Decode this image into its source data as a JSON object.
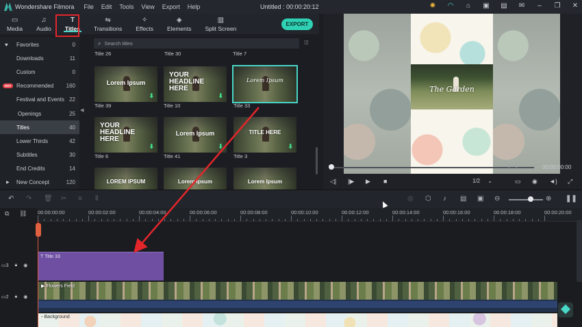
{
  "titlebar": {
    "app_name": "Wondershare Filmora",
    "menu": [
      "File",
      "Edit",
      "Tools",
      "View",
      "Export",
      "Help"
    ],
    "window_title": "Untitled : 00:00:20:12",
    "icons": [
      "lightbulb-icon",
      "headset-icon",
      "store-icon",
      "account-icon",
      "save-icon",
      "mail-icon",
      "minimize-icon",
      "restore-icon",
      "close-icon"
    ]
  },
  "module_tabs": {
    "items": [
      {
        "label": "Media",
        "icon": "folder-icon"
      },
      {
        "label": "Audio",
        "icon": "music-note-icon"
      },
      {
        "label": "Titles",
        "icon": "text-icon"
      },
      {
        "label": "Transitions",
        "icon": "transition-icon"
      },
      {
        "label": "Effects",
        "icon": "effects-icon"
      },
      {
        "label": "Elements",
        "icon": "elements-icon"
      },
      {
        "label": "Split Screen",
        "icon": "split-screen-icon"
      }
    ],
    "active": "Titles",
    "export_label": "EXPORT"
  },
  "sidebar": {
    "items": [
      {
        "label": "Favorites",
        "count": "0"
      },
      {
        "label": "Downloads",
        "count": "11"
      },
      {
        "label": "Custom",
        "count": "0"
      },
      {
        "label": "Recommended",
        "count": "160",
        "badge": "HOT"
      },
      {
        "label": "Festival and Events",
        "count": "22"
      },
      {
        "label": "Openings",
        "count": "25"
      },
      {
        "label": "Titles",
        "count": "40"
      },
      {
        "label": "Lower Thirds",
        "count": "42"
      },
      {
        "label": "Subtitles",
        "count": "30"
      },
      {
        "label": "End Credits",
        "count": "14"
      },
      {
        "label": "New Concept",
        "count": "120"
      }
    ],
    "active": "Titles"
  },
  "search": {
    "placeholder": "Search titles"
  },
  "grid": {
    "top_row_labels": [
      "Title 26",
      "Title 30",
      "Title 7"
    ],
    "rows": [
      [
        {
          "label": "Title 39",
          "text": "Lorem Ipsum"
        },
        {
          "label": "Title 10",
          "text": "YOUR HEADLINE HERE"
        },
        {
          "label": "Title 33",
          "text": "Lorem Ipsum",
          "selected": true
        }
      ],
      [
        {
          "label": "Title 6",
          "text": "YOUR HEADLINE HERE"
        },
        {
          "label": "Title 41",
          "text": "Lorem Ipsum"
        },
        {
          "label": "Title 3",
          "text": "TITLE HERE"
        }
      ],
      [
        {
          "label": "",
          "text": "LOREM IPSUM"
        },
        {
          "label": "",
          "text": "Lorem Ipsum"
        },
        {
          "label": "",
          "text": "Lorem Ipsum"
        }
      ]
    ]
  },
  "preview": {
    "caption": "The Garden",
    "timecode": "00:00:00:00",
    "ratio": "1/2",
    "controls": [
      "step-back-icon",
      "play-pause-icon",
      "play-icon",
      "stop-icon"
    ],
    "right_icons": [
      "monitor-icon",
      "snapshot-icon",
      "volume-icon",
      "fullscreen-icon"
    ]
  },
  "toolbar": {
    "left_tools": [
      "undo-icon",
      "redo-icon",
      "delete-icon",
      "cut-icon",
      "adjust-icon",
      "audio-wave-icon"
    ],
    "right_tools": [
      "speed-icon",
      "marker-icon",
      "mic-icon",
      "voiceover-icon",
      "subtitle-icon",
      "zoom-out-icon",
      "zoom-in-icon",
      "pause-bars-icon"
    ]
  },
  "timeline": {
    "ruler_labels": [
      "00:00:00:00",
      "00:00:02:00",
      "00:00:04:00",
      "00:00:06:00",
      "00:00:08:00",
      "00:00:10:00",
      "00:00:12:00",
      "00:00:14:00",
      "00:00:16:00",
      "00:00:18:00",
      "00:00:20:00"
    ],
    "tracks": [
      {
        "clip_label": "Title 33",
        "type": "title",
        "index": "3"
      },
      {
        "clip_label": "Flowers Field",
        "type": "video",
        "index": "2"
      },
      {
        "clip_label": "Background",
        "type": "image",
        "index": "1"
      }
    ]
  }
}
